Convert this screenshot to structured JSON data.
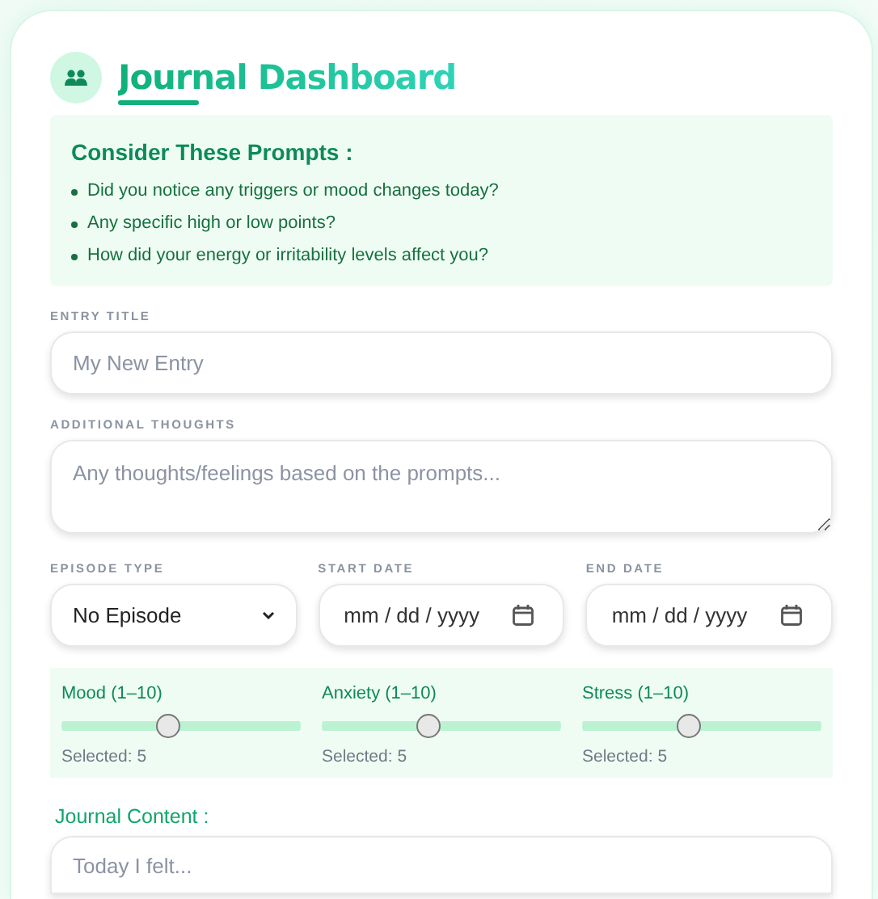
{
  "header": {
    "title": "Journal Dashboard"
  },
  "prompts": {
    "heading": "Consider These Prompts :",
    "items": [
      "Did you notice any triggers or mood changes today?",
      "Any specific high or low points?",
      "How did your energy or irritability levels affect you?"
    ]
  },
  "entry_title": {
    "label": "ENTRY TITLE",
    "placeholder": "My New Entry"
  },
  "additional_thoughts": {
    "label": "ADDITIONAL THOUGHTS",
    "placeholder": "Any thoughts/feelings based on the prompts..."
  },
  "episode_type": {
    "label": "EPISODE TYPE",
    "value": "No Episode"
  },
  "start_date": {
    "label": "START DATE",
    "placeholder": "mm / dd / yyyy"
  },
  "end_date": {
    "label": "END DATE",
    "placeholder": "mm / dd / yyyy"
  },
  "sliders": [
    {
      "label": "Mood (1–10)",
      "level": 0.444,
      "reading": "Selected: 5"
    },
    {
      "label": "Anxiety (1–10)",
      "level": 0.444,
      "reading": "Selected: 5"
    },
    {
      "label": "Stress (1–10)",
      "level": 0.444,
      "reading": "Selected: 5"
    }
  ],
  "journal_content": {
    "label": "Journal Content :",
    "placeholder": "Today I felt..."
  }
}
